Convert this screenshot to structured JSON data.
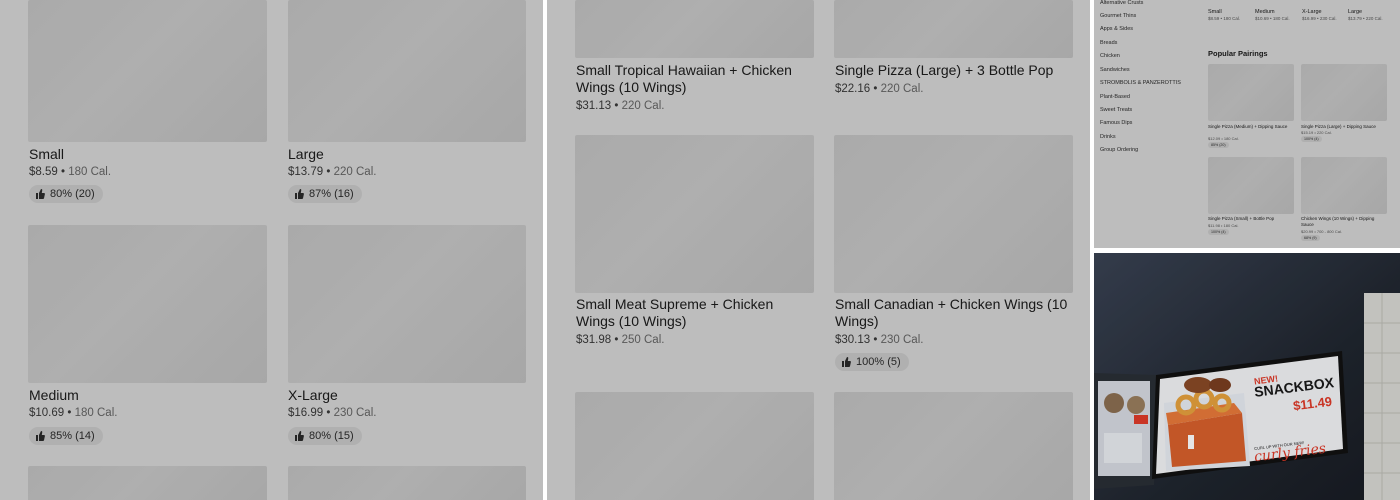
{
  "left_panel": {
    "items": [
      {
        "name": "Small",
        "price": "$8.59",
        "cal": "180 Cal.",
        "rating": "80% (20)"
      },
      {
        "name": "Large",
        "price": "$13.79",
        "cal": "220 Cal.",
        "rating": "87% (16)"
      },
      {
        "name": "Medium",
        "price": "$10.69",
        "cal": "180 Cal.",
        "rating": "85% (14)"
      },
      {
        "name": "X-Large",
        "price": "$16.99",
        "cal": "230 Cal.",
        "rating": "80% (15)"
      }
    ]
  },
  "middle_panel": {
    "items": [
      {
        "name": "Small Tropical Hawaiian + Chicken Wings (10 Wings)",
        "price": "$31.13",
        "cal": "220 Cal."
      },
      {
        "name": "Single Pizza (Large) + 3 Bottle Pop",
        "price": "$22.16",
        "cal": "220 Cal."
      },
      {
        "name": "Small Meat Supreme + Chicken Wings (10 Wings)",
        "price": "$31.98",
        "cal": "250 Cal."
      },
      {
        "name": "Small Canadian + Chicken Wings (10 Wings)",
        "price": "$30.13",
        "cal": "230 Cal.",
        "rating": "100% (5)"
      }
    ]
  },
  "category_menu": {
    "items": [
      "Alternative Crusts",
      "Gourmet Thins",
      "Apps & Sides",
      "Breads",
      "Chicken",
      "Sandwiches",
      "STROMBOLIS & PANZEROTTIS",
      "Plant-Based",
      "Sweet Treats",
      "Famous Dips",
      "Drinks",
      "Group Ordering"
    ]
  },
  "sizes_row": [
    {
      "label": "Small",
      "price": "$8.59 • 180 Cal."
    },
    {
      "label": "Medium",
      "price": "$10.69 • 180 Cal."
    },
    {
      "label": "X-Large",
      "price": "$16.99 • 230 Cal."
    },
    {
      "label": "Large",
      "price": "$13.79 • 220 Cal."
    }
  ],
  "popular_pairings": {
    "title": "Popular Pairings",
    "items": [
      {
        "name": "Single Pizza (Medium) + Dipping Sauce",
        "meta": "$12.09 • 180 Cal.",
        "rating": "85% (20)"
      },
      {
        "name": "Single Pizza (Large) + Dipping Sauce",
        "meta": "$15.19 • 220 Cal.",
        "rating": "100% (4)"
      },
      {
        "name": "Single Pizza (Small) + Bottle Pop",
        "meta": "$11.98 • 180 Cal.",
        "rating": "100% (4)"
      },
      {
        "name": "Chicken Wings (10 Wings) + Dipping Sauce",
        "meta": "$20.99 • 700 - 800 Cal.",
        "rating": "68% (9)"
      }
    ]
  },
  "photo": {
    "headline_new": "NEW!",
    "headline": "SNACKBOX",
    "price": "$11.49",
    "subline": "CURL UP WITH OUR NEW!",
    "script": "curly fries"
  },
  "colors": {
    "accent_red": "#e03b2a",
    "dim_overlay": "rgba(0,0,0,0.26)"
  }
}
